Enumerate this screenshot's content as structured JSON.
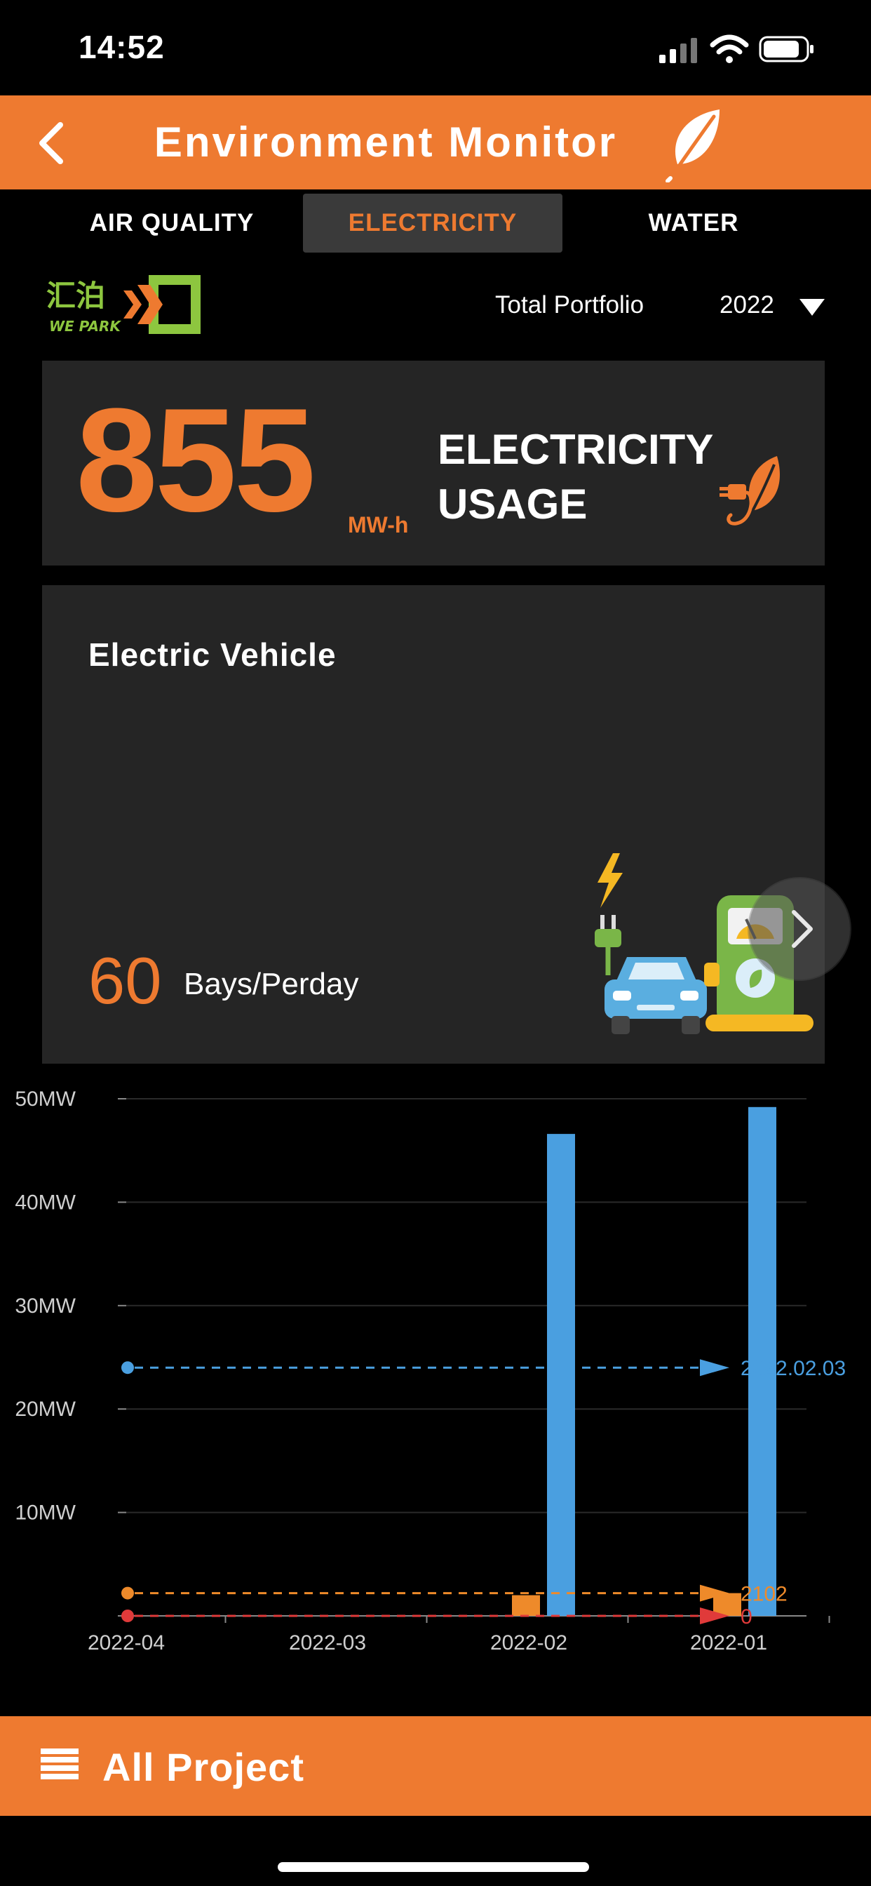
{
  "status": {
    "time": "14:52"
  },
  "header": {
    "title": "Environment Monitor",
    "accent_color": "#ee7a30",
    "icons": [
      "back-chevron-icon",
      "leaf-icon"
    ]
  },
  "tabs": [
    {
      "label": "AIR QUALITY",
      "active": false
    },
    {
      "label": "ELECTRICITY",
      "active": true
    },
    {
      "label": "WATER",
      "active": false
    }
  ],
  "brand": {
    "name_cn": "汇泊",
    "name_en": "WE PARK",
    "color": "#8dc63f"
  },
  "filter": {
    "portfolio_label": "Total Portfolio",
    "year": "2022"
  },
  "usage": {
    "value": "855",
    "unit": "MW-h",
    "label_line1": "ELECTRICITY",
    "label_line2": "USAGE"
  },
  "ev": {
    "title": "Electric Vehicle",
    "value": "60",
    "unit": "Bays/Perday"
  },
  "chart_data": {
    "type": "bar",
    "categories": [
      "2022-04",
      "2022-03",
      "2022-02",
      "2022-01"
    ],
    "series": [
      {
        "values": [
          0,
          0,
          2,
          2.2
        ],
        "color": "#ee8a2a"
      },
      {
        "values": [
          0,
          0,
          46.6,
          49.2
        ],
        "color": "#4a9fe0"
      }
    ],
    "ylim": [
      0,
      50
    ],
    "yticks": [
      "50MW",
      "40MW",
      "30MW",
      "20MW",
      "10MW"
    ],
    "yticks_values": [
      50,
      40,
      30,
      20,
      10
    ],
    "grid": true,
    "mark_lines": [
      {
        "value": 24,
        "label": "2022.02.03",
        "color": "#4a9fe0"
      },
      {
        "value": 2.2,
        "label": "2102",
        "color": "#ee8a2a"
      },
      {
        "value": 0,
        "label": "0",
        "color": "#e03a3a"
      }
    ]
  },
  "bottom": {
    "label": "All Project"
  }
}
